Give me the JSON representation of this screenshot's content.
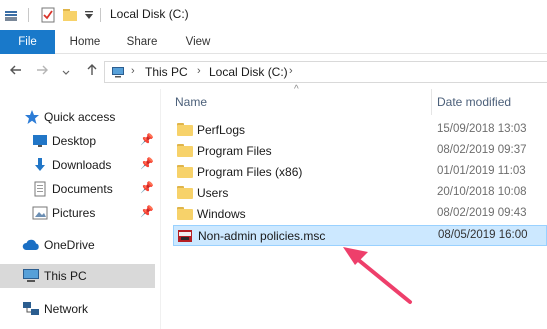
{
  "window": {
    "title": "Local Disk (C:)"
  },
  "ribbon": {
    "tabs": [
      "File",
      "Home",
      "Share",
      "View"
    ]
  },
  "address": {
    "crumbs": [
      "This PC",
      "Local Disk (C:)"
    ]
  },
  "nav": {
    "items": [
      {
        "label": "Quick access",
        "icon": "star-icon",
        "pinned": false
      },
      {
        "label": "Desktop",
        "icon": "desktop-icon",
        "pinned": true
      },
      {
        "label": "Downloads",
        "icon": "download-icon",
        "pinned": true
      },
      {
        "label": "Documents",
        "icon": "documents-icon",
        "pinned": true
      },
      {
        "label": "Pictures",
        "icon": "pictures-icon",
        "pinned": true
      },
      {
        "label": "OneDrive",
        "icon": "cloud-icon",
        "pinned": false
      },
      {
        "label": "This PC",
        "icon": "computer-icon",
        "pinned": false
      },
      {
        "label": "Network",
        "icon": "network-icon",
        "pinned": false
      }
    ]
  },
  "list": {
    "headers": {
      "name": "Name",
      "date": "Date modified"
    },
    "rows": [
      {
        "name": "PerfLogs",
        "date": "15/09/2018 13:03",
        "type": "folder"
      },
      {
        "name": "Program Files",
        "date": "08/02/2019 09:37",
        "type": "folder"
      },
      {
        "name": "Program Files (x86)",
        "date": "01/01/2019 11:03",
        "type": "folder"
      },
      {
        "name": "Users",
        "date": "20/10/2018 10:08",
        "type": "folder"
      },
      {
        "name": "Windows",
        "date": "08/02/2019 09:43",
        "type": "folder"
      },
      {
        "name": "Non-admin policies.msc",
        "date": "08/05/2019 16:00",
        "type": "msc"
      }
    ]
  },
  "colors": {
    "accent": "#1979ca",
    "selection": "#cce8ff",
    "annotation": "#ee3f6b"
  }
}
